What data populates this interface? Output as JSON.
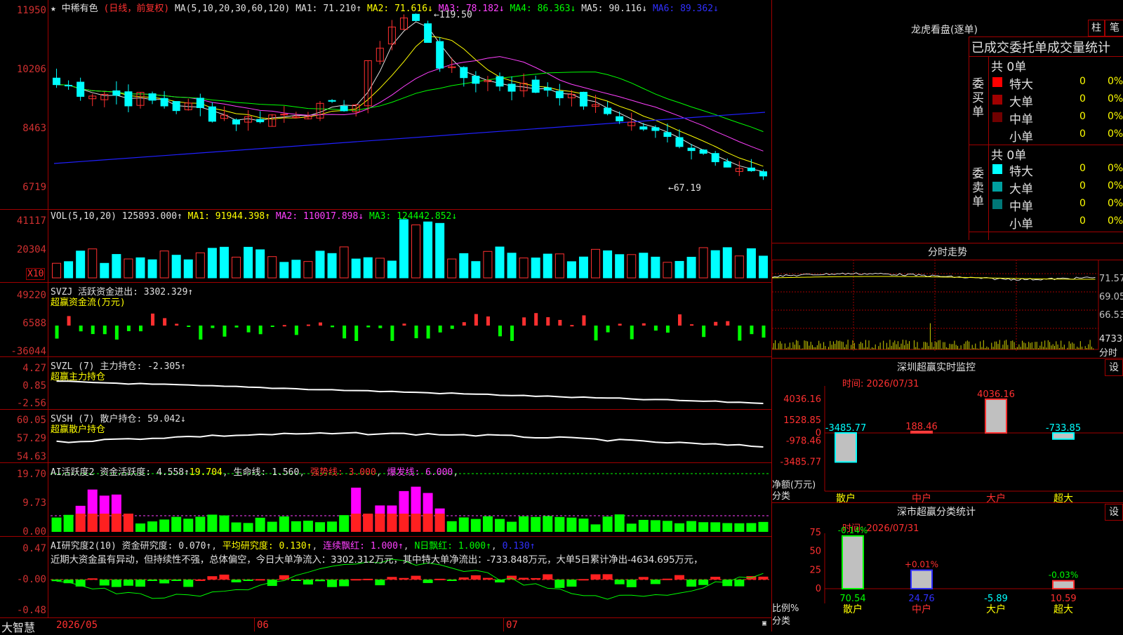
{
  "main": {
    "star": "★",
    "name": "中稀有色",
    "mode": "(日线，前复权)",
    "ma_header": "MA(5,10,20,30,60,120)",
    "ma": [
      {
        "label": "MA1:",
        "value": "71.210↑",
        "color": "#e0e0e0"
      },
      {
        "label": "MA2:",
        "value": "71.616↓",
        "color": "#ffff00"
      },
      {
        "label": "MA3:",
        "value": "78.182↓",
        "color": "#ff40ff"
      },
      {
        "label": "MA4:",
        "value": "86.363↓",
        "color": "#00ff00"
      },
      {
        "label": "MA5:",
        "value": "90.116↓",
        "color": "#e0e0e0"
      },
      {
        "label": "MA6:",
        "value": "89.362↓",
        "color": "#3030ff"
      }
    ],
    "y_ticks": [
      "11950",
      "10206",
      "8463",
      "6719"
    ],
    "high_label": "←119.50",
    "low_label": "←67.19"
  },
  "vol": {
    "header": "VOL(5,10,20)",
    "value": "125893.000↑",
    "ma1": "MA1: 91944.398↑",
    "ma2": "MA2: 110017.898↓",
    "ma3": "MA3: 124442.852↓",
    "y_ticks": [
      "41117",
      "20304"
    ],
    "unit": "X10"
  },
  "svzj": {
    "header": "SVZJ  活跃资金进出: 3302.329↑",
    "sub": "超赢资金流(万元)",
    "y_ticks": [
      "49220",
      "6588",
      "-36044"
    ]
  },
  "svzl": {
    "header": "SVZL (7) 主力持仓: -2.305↑",
    "sub": "超赢主力持仓",
    "y_ticks": [
      "4.27",
      "0.85",
      "-2.56"
    ]
  },
  "svsh": {
    "header": "SVSH (7) 散户持仓: 59.042↓",
    "sub": "超赢散户持仓",
    "y_ticks": [
      "60.05",
      "57.29",
      "54.63"
    ]
  },
  "ai1": {
    "header": "AI活跃度2 资金活跃度: 4.558↑",
    "v2": "19.704",
    "life": "生命线: 1.560",
    "strong": "强势线: 3.000",
    "burst": "爆发线: 6.000",
    "y_ticks": [
      "19.70",
      "9.73",
      "0.00"
    ]
  },
  "ai2": {
    "header": "AI研究度2(10) 资金研究度: 0.070↑",
    "avg": "平均研究度: 0.130↑",
    "red": "连续飘红: 1.000↑",
    "nred": "N日飘红: 1.000↑",
    "last": "0.130↑",
    "text": "近期大资金虽有异动，但持续性不强，总体偏空，今日大单净流入：3302.312万元，其中特大单净流出：-733.848万元，大单5日累计净出-4634.695万元，",
    "y_ticks": [
      "0.47",
      "-0.00",
      "-0.48"
    ]
  },
  "bottom": {
    "brand": "大智慧",
    "dates": [
      "2026/05",
      "06",
      "07"
    ]
  },
  "dragon": {
    "title": "龙虎看盘(逐单)",
    "btn1": "柱",
    "btn2": "笔",
    "stat_title": "已成交委托单成交量统计",
    "buy_label": "委买单",
    "sell_label": "委卖单",
    "buy_total": "共 0单",
    "sell_total": "共 0单",
    "buy_rows": [
      {
        "name": "特大",
        "count": "0",
        "pct": "0%",
        "color": "#ff0000"
      },
      {
        "name": "大单",
        "count": "0",
        "pct": "0%",
        "color": "#a00000"
      },
      {
        "name": "中单",
        "count": "0",
        "pct": "0%",
        "color": "#700000"
      },
      {
        "name": "小单",
        "count": "0",
        "pct": "0%",
        "color": ""
      }
    ],
    "sell_rows": [
      {
        "name": "特大",
        "count": "0",
        "pct": "0%",
        "color": "#00ffff"
      },
      {
        "name": "大单",
        "count": "0",
        "pct": "0%",
        "color": "#00a0a0"
      },
      {
        "name": "中单",
        "count": "0",
        "pct": "0%",
        "color": "#007878"
      },
      {
        "name": "小单",
        "count": "0",
        "pct": "0%",
        "color": ""
      }
    ]
  },
  "intraday": {
    "title": "分时走势",
    "y_ticks": [
      "71.57",
      "69.05",
      "66.53",
      "4733"
    ],
    "vol_label": "分时"
  },
  "monitor": {
    "title": "深圳超赢实时监控",
    "set": "设",
    "time": "时间: 2026/07/31",
    "y_ticks": [
      "4036.16",
      "1528.85",
      "0",
      "-978.46",
      "-3485.77"
    ],
    "y_unit": "净额(万元)",
    "x_unit": "分类",
    "bars": [
      {
        "cat": "散户",
        "value": "-3485.77",
        "color": "#00ffff"
      },
      {
        "cat": "中户",
        "value": "188.46",
        "color": "#ff3030"
      },
      {
        "cat": "大户",
        "value": "4036.16",
        "color": "#ff3030"
      },
      {
        "cat": "超大",
        "value": "-733.85",
        "color": "#00ffff"
      }
    ]
  },
  "stats": {
    "title": "深市超赢分类统计",
    "set": "设",
    "time": "时间: 2026/07/31",
    "y_ticks": [
      "75",
      "50",
      "25",
      "0"
    ],
    "y_unit": "比例%",
    "x_unit": "分类",
    "bars": [
      {
        "cat": "散户",
        "value": "70.54",
        "change": "-0.14%",
        "cat_color": "#ffff00",
        "val_color": "#00ff00",
        "chg_color": "#00ff00"
      },
      {
        "cat": "中户",
        "value": "24.76",
        "change": "+0.01%",
        "cat_color": "#ff3030",
        "val_color": "#3030ff",
        "chg_color": "#ff3030"
      },
      {
        "cat": "大户",
        "value": "-5.89",
        "change": "",
        "cat_color": "#ffff00",
        "val_color": "#00ffff",
        "chg_color": "#00ff00"
      },
      {
        "cat": "超大",
        "value": "10.59",
        "change": "-0.03%",
        "cat_color": "#ffff00",
        "val_color": "#ff3030",
        "chg_color": "#00ff00"
      }
    ]
  },
  "colors": {
    "up": "#ff3030",
    "down": "#00ffff",
    "grid": "#a00000"
  }
}
